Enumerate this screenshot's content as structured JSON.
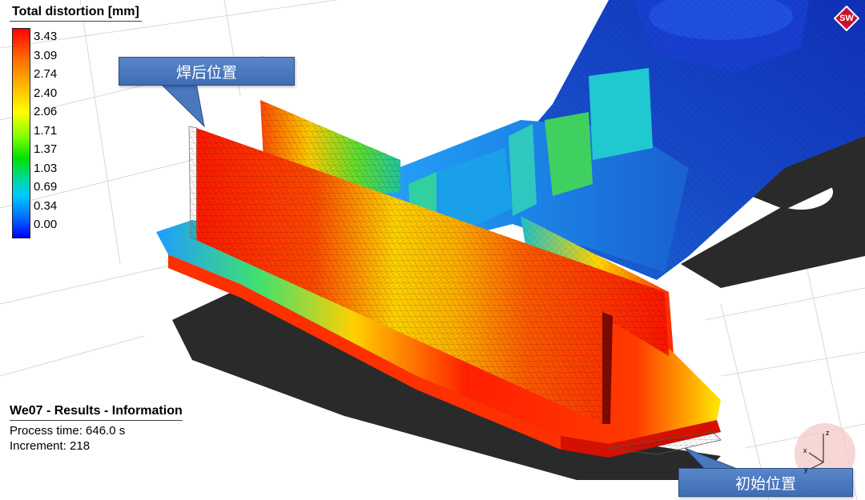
{
  "legend": {
    "title": "Total distortion [mm]",
    "ticks": [
      "3.43",
      "3.09",
      "2.74",
      "2.40",
      "2.06",
      "1.71",
      "1.37",
      "1.03",
      "0.69",
      "0.34",
      "0.00"
    ],
    "colors": {
      "max": "#ff0000",
      "high": "#ffb000",
      "mid_high": "#ffff00",
      "mid": "#00e000",
      "mid_low": "#00c8ff",
      "min": "#0000ff"
    }
  },
  "callouts": {
    "after_weld": "焊后位置",
    "initial": "初始位置",
    "color": "#4a78be"
  },
  "info": {
    "title": "We07 - Results - Information",
    "process_time_label": "Process time:",
    "process_time_value": "646.0 s",
    "increment_label": "Increment:",
    "increment_value": "218"
  },
  "logo": {
    "text": "SW",
    "color": "#c8102e"
  },
  "triad": {
    "axes": [
      "z",
      "x",
      "y"
    ]
  }
}
